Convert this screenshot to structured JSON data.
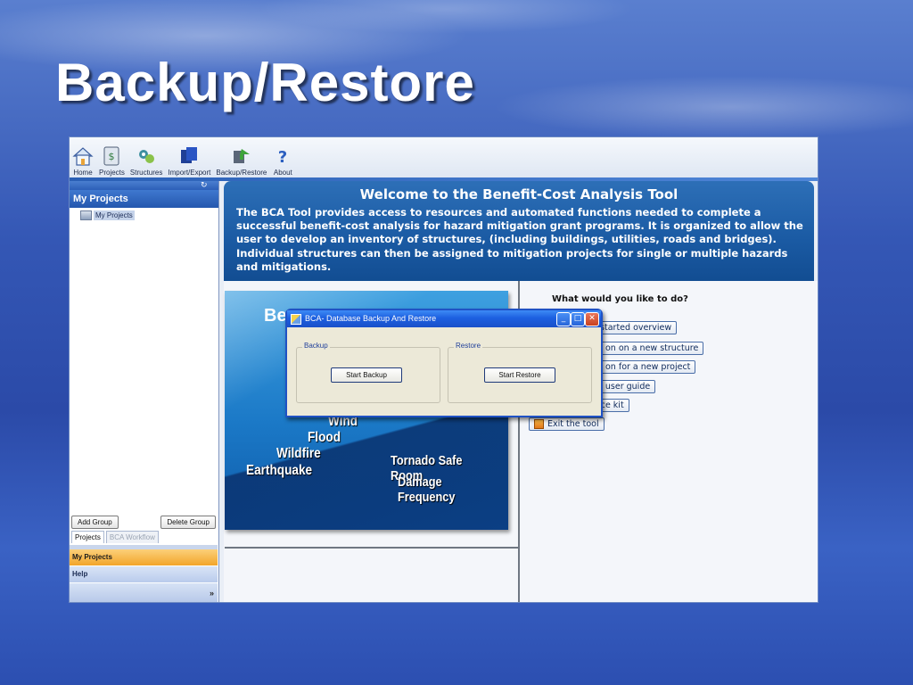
{
  "slide": {
    "title": "Backup/Restore"
  },
  "toolbar": {
    "items": [
      {
        "label": "Home",
        "icon": "home-icon"
      },
      {
        "label": "Projects",
        "icon": "projects-icon"
      },
      {
        "label": "Structures",
        "icon": "structures-icon"
      },
      {
        "label": "Import/Export",
        "icon": "import-export-icon"
      },
      {
        "label": "Backup/Restore",
        "icon": "backup-restore-icon"
      },
      {
        "label": "About",
        "icon": "help-icon"
      }
    ]
  },
  "sidebar": {
    "header": "My Projects",
    "tree_item": "My Projects",
    "add_group": "Add Group",
    "delete_group": "Delete Group",
    "tabs": [
      "Projects",
      "BCA Workflow"
    ],
    "nav": [
      "My Projects",
      "Help"
    ]
  },
  "welcome": {
    "title": "Welcome to the Benefit-Cost Analysis Tool",
    "body": "The BCA Tool provides access to resources and automated functions needed to complete a successful benefit-cost analysis for hazard mitigation grant programs.  It is organized to allow the user to develop an inventory of structures, (including buildings, utilities, roads and bridges). Individual structures can then be assigned to mitigation projects for single or multiple hazards and mitigations."
  },
  "image_panel": {
    "title": "Be",
    "words": [
      "Wind",
      "Flood",
      "Wildfire",
      "Earthquake",
      "Tornado Safe Room",
      "Damage Frequency"
    ]
  },
  "actions": {
    "question": "What would you like to do?",
    "buttons": [
      "g started overview",
      "on on a new structure",
      "on for a new project",
      "he user guide",
      "urce kit",
      "Exit the tool"
    ]
  },
  "dialog": {
    "title": "BCA- Database Backup And Restore",
    "backup_group": "Backup",
    "restore_group": "Restore",
    "start_backup": "Start Backup",
    "start_restore": "Start Restore"
  },
  "colors": {
    "accent_blue": "#1a5aa3",
    "xp_title_blue": "#1c5fe0",
    "nav_orange": "#f2a52a"
  }
}
